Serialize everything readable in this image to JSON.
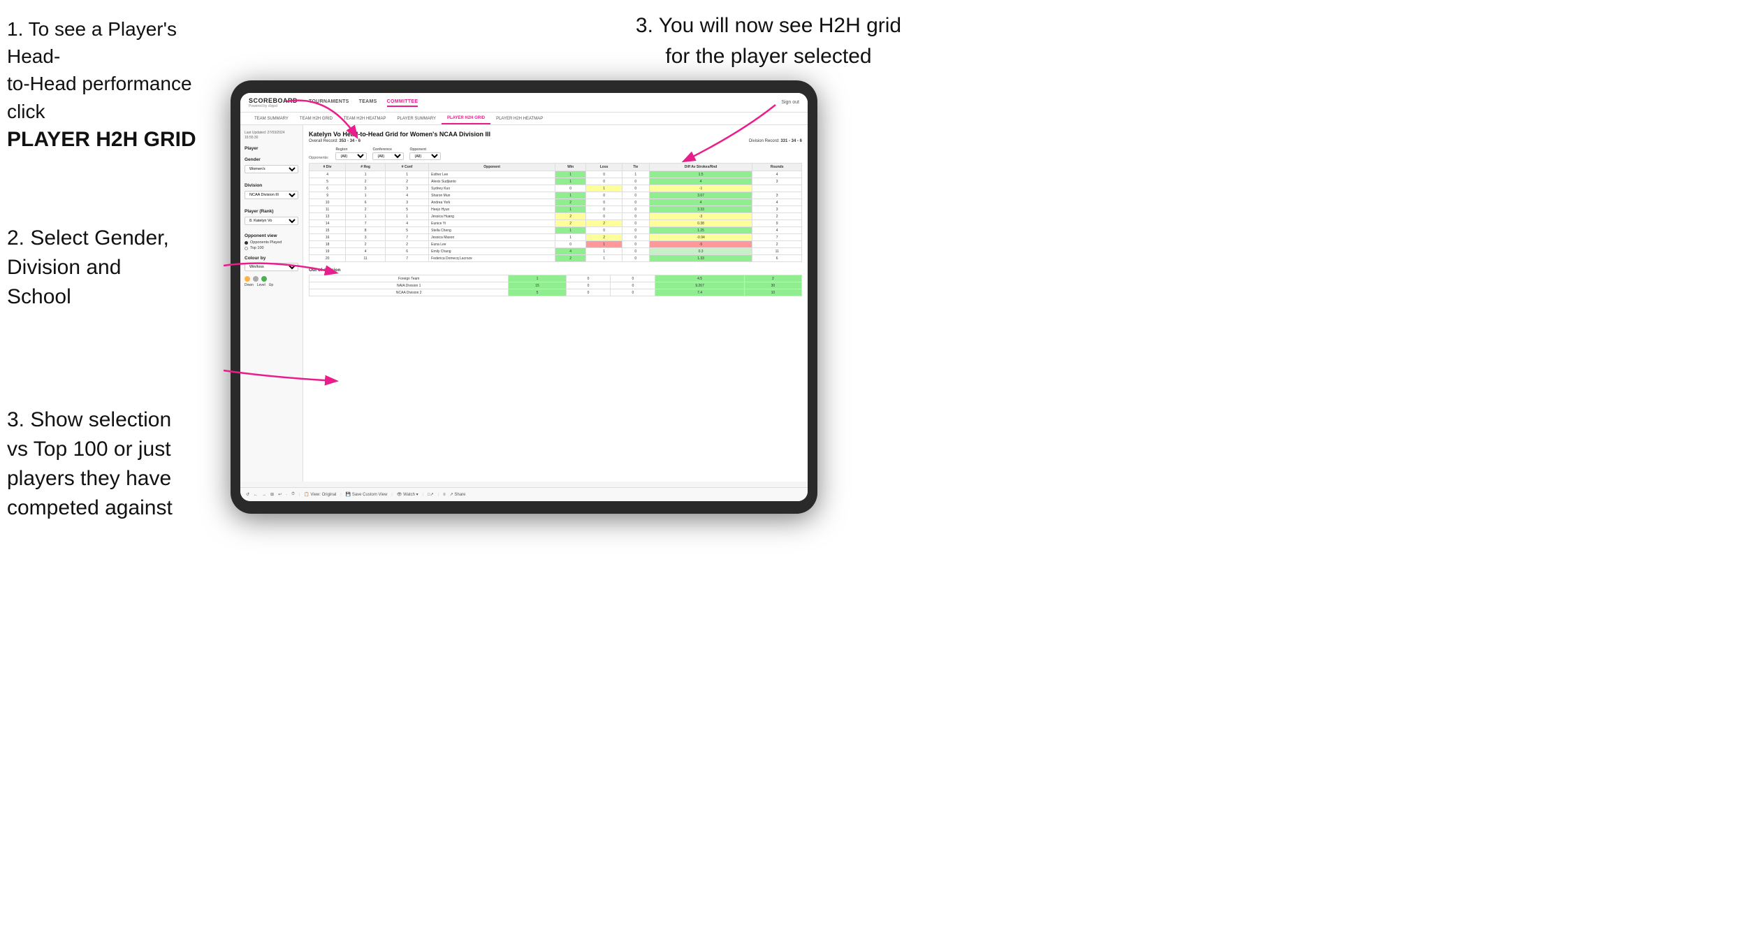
{
  "annotations": {
    "annotation1": "1. To see a Player's Head-to-Head performance click",
    "annotation1_bold": "PLAYER H2H GRID",
    "annotation2_title": "2. Select Gender,\nDivision and\nSchool",
    "annotation3_top": "3. You will now see H2H grid\nfor the player selected",
    "annotation3_left_title": "3. Show selection\nvs Top 100 or just\nplayers they have\ncompeted against"
  },
  "header": {
    "logo": "SCOREBOARD",
    "powered_by": "Powered by clippd",
    "nav": [
      "TOURNAMENTS",
      "TEAMS",
      "COMMITTEE"
    ],
    "active_nav": "COMMITTEE",
    "sign_out": "Sign out"
  },
  "sub_nav": {
    "items": [
      "TEAM SUMMARY",
      "TEAM H2H GRID",
      "TEAM H2H HEATMAP",
      "PLAYER SUMMARY",
      "PLAYER H2H GRID",
      "PLAYER H2H HEATMAP"
    ],
    "active": "PLAYER H2H GRID"
  },
  "left_panel": {
    "last_updated_label": "Last Updated: 27/03/2024",
    "last_updated_time": "16:55:30",
    "player_label": "Player",
    "gender_label": "Gender",
    "gender_value": "Women's",
    "division_label": "Division",
    "division_value": "NCAA Division III",
    "player_rank_label": "Player (Rank)",
    "player_rank_value": "8. Katelyn Vo",
    "opponent_view_label": "Opponent view",
    "radio_1": "Opponents Played",
    "radio_2": "Top 100",
    "colour_by_label": "Colour by",
    "colour_by_value": "Win/loss",
    "legend": {
      "down": "Down",
      "level": "Level",
      "up": "Up"
    }
  },
  "grid": {
    "title": "Katelyn Vo Head-to-Head Grid for Women's NCAA Division III",
    "overall_record_label": "Overall Record:",
    "overall_record": "353 - 34 - 6",
    "division_record_label": "Division Record:",
    "division_record": "331 - 34 - 6",
    "filters": {
      "region_label": "Region",
      "conference_label": "Conference",
      "opponent_label": "Opponent",
      "opponents_label": "Opponents:",
      "region_value": "(All)",
      "conference_value": "(All)",
      "opponent_value": "(All)"
    },
    "table_headers": [
      "# Div",
      "# Reg",
      "# Conf",
      "Opponent",
      "Win",
      "Loss",
      "Tie",
      "Diff Av Strokes/Rnd",
      "Rounds"
    ],
    "rows": [
      {
        "div": 4,
        "reg": 1,
        "conf": 1,
        "opponent": "Esther Lee",
        "win": 1,
        "loss": 0,
        "tie": 1,
        "diff": 1.5,
        "rounds": 4,
        "win_class": "cell-green",
        "loss_class": "",
        "diff_class": "cell-green"
      },
      {
        "div": 5,
        "reg": 2,
        "conf": 2,
        "opponent": "Alexis Sudjianto",
        "win": 1,
        "loss": 0,
        "tie": 0,
        "diff": 4.0,
        "rounds": 3,
        "win_class": "cell-green",
        "loss_class": "",
        "diff_class": "cell-green"
      },
      {
        "div": 6,
        "reg": 3,
        "conf": 3,
        "opponent": "Sydney Kuo",
        "win": 0,
        "loss": 1,
        "tie": 0,
        "diff": -1.0,
        "rounds": "",
        "win_class": "",
        "loss_class": "cell-yellow",
        "diff_class": "cell-yellow"
      },
      {
        "div": 9,
        "reg": 1,
        "conf": 4,
        "opponent": "Sharon Mun",
        "win": 1,
        "loss": 0,
        "tie": 0,
        "diff": 3.67,
        "rounds": 3,
        "win_class": "cell-green",
        "loss_class": "",
        "diff_class": "cell-green"
      },
      {
        "div": 10,
        "reg": 6,
        "conf": 3,
        "opponent": "Andrea York",
        "win": 2,
        "loss": 0,
        "tie": 0,
        "diff": 4.0,
        "rounds": 4,
        "win_class": "cell-green",
        "loss_class": "",
        "diff_class": "cell-green"
      },
      {
        "div": 11,
        "reg": 2,
        "conf": 5,
        "opponent": "Heejo Hyun",
        "win": 1,
        "loss": 0,
        "tie": 0,
        "diff": 3.33,
        "rounds": 3,
        "win_class": "cell-green",
        "loss_class": "",
        "diff_class": "cell-green"
      },
      {
        "div": 13,
        "reg": 1,
        "conf": 1,
        "opponent": "Jessica Huang",
        "win": 2,
        "loss": 0,
        "tie": 0,
        "diff": -3.0,
        "rounds": 2,
        "win_class": "cell-yellow",
        "loss_class": "",
        "diff_class": "cell-yellow"
      },
      {
        "div": 14,
        "reg": 7,
        "conf": 4,
        "opponent": "Eunice Yi",
        "win": 2,
        "loss": 2,
        "tie": 0,
        "diff": 0.38,
        "rounds": 9,
        "win_class": "cell-yellow",
        "loss_class": "cell-yellow",
        "diff_class": "cell-yellow"
      },
      {
        "div": 15,
        "reg": 8,
        "conf": 5,
        "opponent": "Stella Cheng",
        "win": 1,
        "loss": 0,
        "tie": 0,
        "diff": 1.25,
        "rounds": 4,
        "win_class": "cell-green",
        "loss_class": "",
        "diff_class": "cell-green"
      },
      {
        "div": 16,
        "reg": 3,
        "conf": 7,
        "opponent": "Jessica Mason",
        "win": 1,
        "loss": 2,
        "tie": 0,
        "diff": -0.94,
        "rounds": 7,
        "win_class": "",
        "loss_class": "cell-yellow",
        "diff_class": "cell-yellow"
      },
      {
        "div": 18,
        "reg": 2,
        "conf": 2,
        "opponent": "Euna Lee",
        "win": 0,
        "loss": 1,
        "tie": 0,
        "diff": -5.0,
        "rounds": 2,
        "win_class": "",
        "loss_class": "cell-red",
        "diff_class": "cell-red"
      },
      {
        "div": 19,
        "reg": 4,
        "conf": 6,
        "opponent": "Emily Chang",
        "win": 4,
        "loss": 1,
        "tie": 0,
        "diff": 0.3,
        "rounds": 11,
        "win_class": "cell-green",
        "loss_class": "",
        "diff_class": "cell-light-green"
      },
      {
        "div": 20,
        "reg": 11,
        "conf": 7,
        "opponent": "Federica Domecq Lacroze",
        "win": 2,
        "loss": 1,
        "tie": 0,
        "diff": 1.33,
        "rounds": 6,
        "win_class": "cell-green",
        "loss_class": "",
        "diff_class": "cell-green"
      }
    ],
    "out_of_division_label": "Out of division",
    "out_of_division_rows": [
      {
        "team": "Foreign Team",
        "win": 1,
        "loss": 0,
        "tie": 0,
        "diff": 4.5,
        "rounds": 2
      },
      {
        "team": "NAIA Division 1",
        "win": 15,
        "loss": 0,
        "tie": 0,
        "diff": 9.267,
        "rounds": 30
      },
      {
        "team": "NCAA Division 2",
        "win": 5,
        "loss": 0,
        "tie": 0,
        "diff": 7.4,
        "rounds": 10
      }
    ]
  },
  "toolbar": {
    "buttons": [
      "↺",
      "←",
      "→",
      "⊞",
      "↩",
      "·",
      "⏱",
      "View: Original",
      "Save Custom View",
      "Watch ▾",
      "□↗",
      "≡",
      "Share"
    ]
  }
}
